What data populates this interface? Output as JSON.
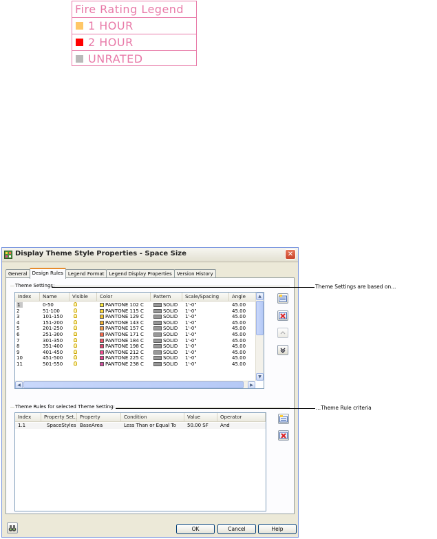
{
  "legend": {
    "title": "Fire Rating Legend",
    "items": [
      {
        "label": "1  HOUR",
        "color": "#ffc767"
      },
      {
        "label": "2  HOUR",
        "color": "#ff0000"
      },
      {
        "label": "UNRATED",
        "color": "#b9b9b9"
      }
    ],
    "border_color": "#e87aa8"
  },
  "dialog": {
    "title": "Display Theme Style Properties - Space Size",
    "close_label": "✕",
    "tabs": [
      {
        "label": "General",
        "active": false
      },
      {
        "label": "Design Rules",
        "active": true
      },
      {
        "label": "Legend Format",
        "active": false
      },
      {
        "label": "Legend Display Properties",
        "active": false
      },
      {
        "label": "Version History",
        "active": false
      }
    ],
    "theme_settings": {
      "label": "Theme Settings:",
      "columns": [
        "Index",
        "Name",
        "Visible",
        "Color",
        "Pattern",
        "Scale/Spacing",
        "Angle"
      ],
      "rows": [
        {
          "index": "1",
          "name": "0-50",
          "color_name": "PANTONE 102 C",
          "color": "#ffeb3b",
          "pattern": "SOLID",
          "scale": "1'-0\"",
          "angle": "45.00",
          "selected": true
        },
        {
          "index": "2",
          "name": "51-100",
          "color_name": "PANTONE 115 C",
          "color": "#ffd93b",
          "pattern": "SOLID",
          "scale": "1'-0\"",
          "angle": "45.00"
        },
        {
          "index": "3",
          "name": "101-150",
          "color_name": "PANTONE 129 C",
          "color": "#f4c430",
          "pattern": "SOLID",
          "scale": "1'-0\"",
          "angle": "45.00"
        },
        {
          "index": "4",
          "name": "151-200",
          "color_name": "PANTONE 143 C",
          "color": "#f2b134",
          "pattern": "SOLID",
          "scale": "1'-0\"",
          "angle": "45.00"
        },
        {
          "index": "5",
          "name": "201-250",
          "color_name": "PANTONE 157 C",
          "color": "#f09a4c",
          "pattern": "SOLID",
          "scale": "1'-0\"",
          "angle": "45.00"
        },
        {
          "index": "6",
          "name": "251-300",
          "color_name": "PANTONE 171 C",
          "color": "#f26b4f",
          "pattern": "SOLID",
          "scale": "1'-0\"",
          "angle": "45.00"
        },
        {
          "index": "7",
          "name": "301-350",
          "color_name": "PANTONE 184 C",
          "color": "#f2576a",
          "pattern": "SOLID",
          "scale": "1'-0\"",
          "angle": "45.00"
        },
        {
          "index": "8",
          "name": "351-400",
          "color_name": "PANTONE 198 C",
          "color": "#e2456f",
          "pattern": "SOLID",
          "scale": "1'-0\"",
          "angle": "45.00"
        },
        {
          "index": "9",
          "name": "401-450",
          "color_name": "PANTONE 212 C",
          "color": "#ef4f91",
          "pattern": "SOLID",
          "scale": "1'-0\"",
          "angle": "45.00"
        },
        {
          "index": "10",
          "name": "451-500",
          "color_name": "PANTONE 225 C",
          "color": "#e6418f",
          "pattern": "SOLID",
          "scale": "1'-0\"",
          "angle": "45.00"
        },
        {
          "index": "11",
          "name": "501-550",
          "color_name": "PANTONE 238 C",
          "color": "#d350a0",
          "pattern": "SOLID",
          "scale": "1'-0\"",
          "angle": "45.00"
        }
      ]
    },
    "theme_rules": {
      "label": "Theme Rules for selected Theme Setting:",
      "columns": [
        "Index",
        "Property Set...",
        "Property",
        "Condition",
        "Value",
        "Operator"
      ],
      "rows": [
        {
          "index": "1.1",
          "property_set": "SpaceStyles",
          "property": "BaseArea",
          "condition": "Less Than or Equal To",
          "value": "50.00 SF",
          "operator": "And"
        }
      ]
    },
    "buttons": {
      "ok": "OK",
      "cancel": "Cancel",
      "help": "Help"
    }
  },
  "callouts": {
    "theme_settings": "Theme Settings are based on...",
    "theme_rules": "...Theme Rule criteria"
  }
}
